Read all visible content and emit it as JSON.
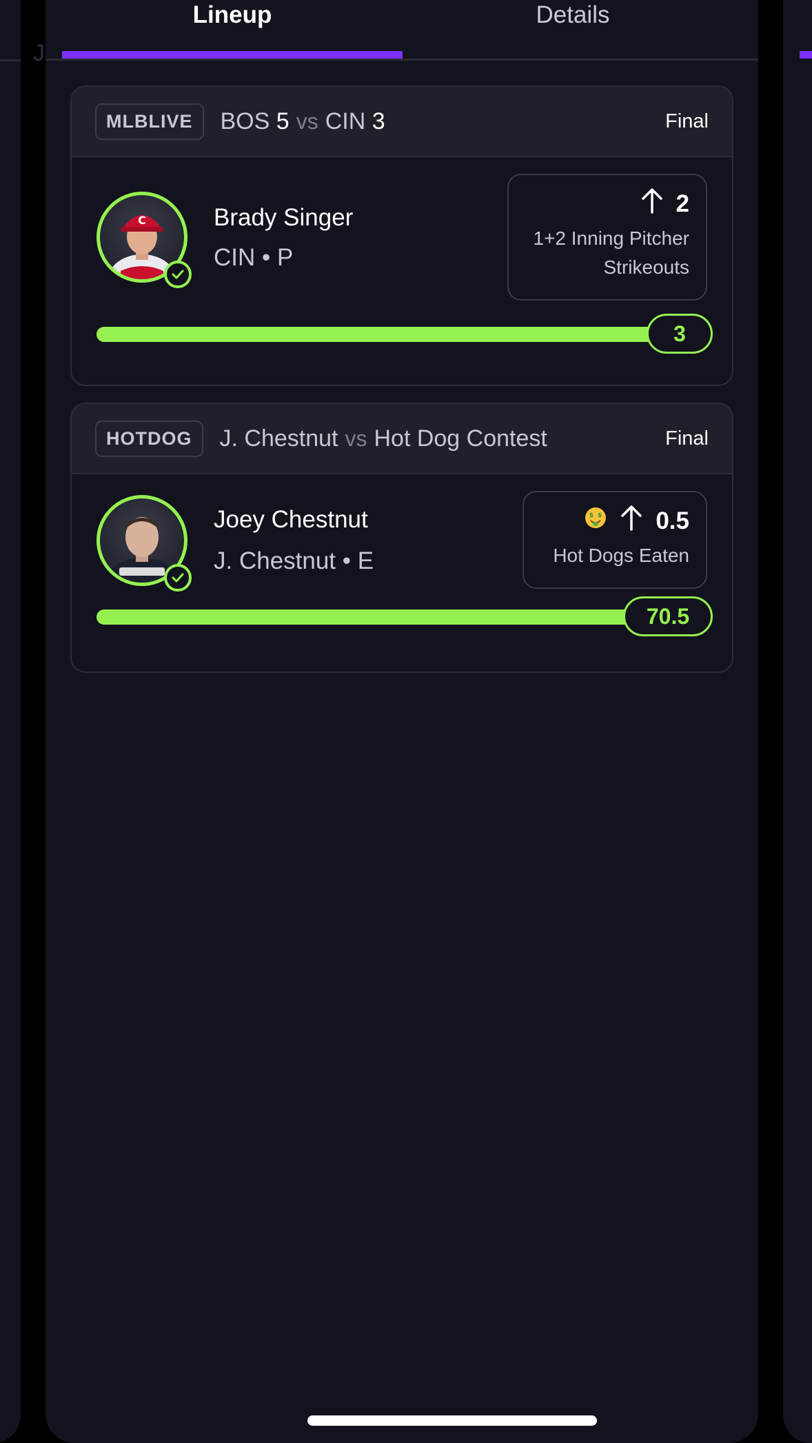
{
  "tabs": [
    {
      "label": "Lineup",
      "active": true
    },
    {
      "label": "Details",
      "active": false
    }
  ],
  "peek": {
    "left_letter": "J"
  },
  "picks": [
    {
      "league": "MLBLIVE",
      "matchup": {
        "away": "BOS",
        "away_score": "5",
        "vs": "vs",
        "home": "CIN",
        "home_score": "3"
      },
      "status": "Final",
      "player": {
        "name": "Brady Singer",
        "meta": "CIN • P",
        "avatar_icon": "baseball-player-avatar"
      },
      "prop": {
        "direction_icon": "arrow-up-icon",
        "line": "2",
        "description": "1+2 Inning Pitcher Strikeouts"
      },
      "result": {
        "value": "3",
        "progress_fraction": 1.0
      }
    },
    {
      "league": "HOTDOG",
      "matchup": {
        "away": "J. Chestnut",
        "vs": "vs",
        "home": "Hot Dog Contest"
      },
      "status": "Final",
      "player": {
        "name": "Joey Chestnut",
        "meta": "J. Chestnut • E",
        "avatar_icon": "contestant-avatar"
      },
      "prop": {
        "emoji": "🤑",
        "direction_icon": "arrow-up-icon",
        "line": "0.5",
        "description": "Hot Dogs Eaten"
      },
      "result": {
        "value": "70.5",
        "progress_fraction": 1.0
      }
    }
  ],
  "colors": {
    "accent_purple": "#7b2ff7",
    "success_green": "#95f150",
    "background": "#12131d",
    "card_header": "#1f2029"
  }
}
